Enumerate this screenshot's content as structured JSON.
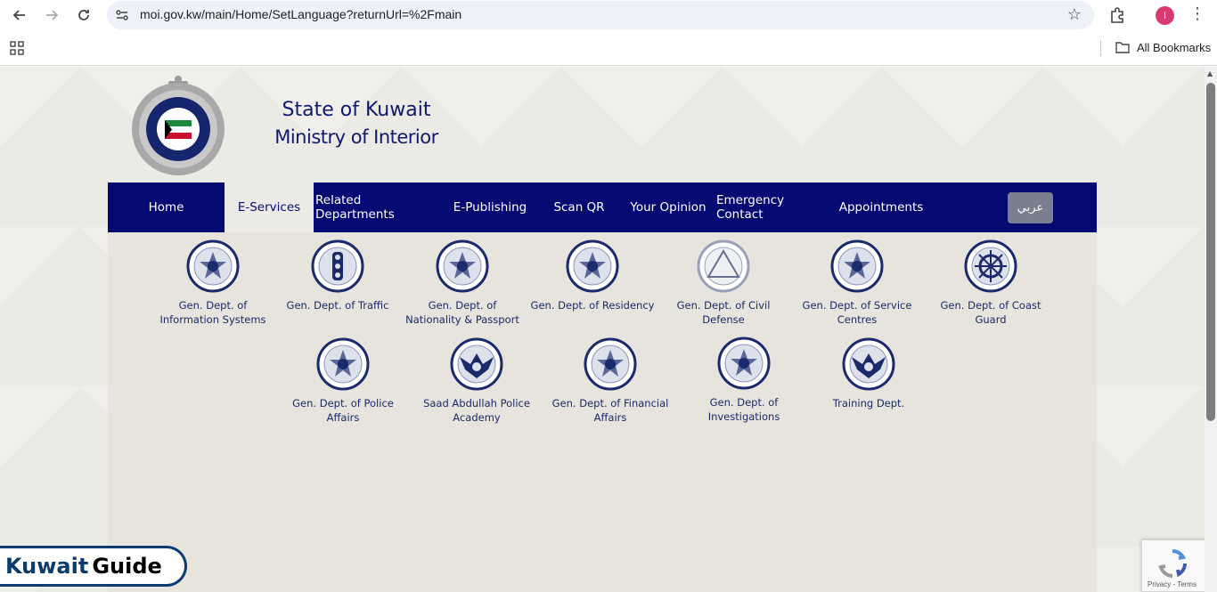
{
  "browser": {
    "url": "moi.gov.kw/main/Home/SetLanguage?returnUrl=%2Fmain",
    "profile_initial": "I",
    "bookmarks_label": "All Bookmarks",
    "icons": [
      "back-icon",
      "forward-icon",
      "reload-icon",
      "site-info-icon",
      "star-icon",
      "extensions-icon",
      "more-icon",
      "apps-icon",
      "folder-icon"
    ]
  },
  "header": {
    "title_line1": "State of Kuwait",
    "title_line2": "Ministry of Interior"
  },
  "nav": {
    "items": [
      {
        "label": "Home",
        "active": false
      },
      {
        "label": "E-Services",
        "active": true
      },
      {
        "label": "Related Departments",
        "active": false
      },
      {
        "label": "E-Publishing",
        "active": false
      },
      {
        "label": "Scan QR",
        "active": false
      },
      {
        "label": "Your Opinion",
        "active": false
      },
      {
        "label": "Emergency Contact",
        "active": false
      },
      {
        "label": "Appointments",
        "active": false
      }
    ],
    "language_button": "عربي"
  },
  "services": [
    {
      "label": "Gen. Dept. of Information Systems",
      "icon": "star-emblem"
    },
    {
      "label": "Gen. Dept. of Traffic",
      "icon": "traffic-emblem"
    },
    {
      "label": "Gen. Dept. of Nationality & Passport",
      "icon": "star-emblem"
    },
    {
      "label": "Gen. Dept. of Residency",
      "icon": "star-emblem"
    },
    {
      "label": "Gen. Dept. of Civil Defense",
      "icon": "triangle-emblem"
    },
    {
      "label": "Gen. Dept. of Service Centres",
      "icon": "star-emblem"
    },
    {
      "label": "Gen. Dept. of Coast Guard",
      "icon": "wheel-emblem"
    },
    {
      "label": "Gen. Dept. of Police Affairs",
      "icon": "star-emblem"
    },
    {
      "label": "Saad Abdullah Police Academy",
      "icon": "eagle-emblem"
    },
    {
      "label": "Gen. Dept. of Financial Affairs",
      "icon": "star-emblem"
    },
    {
      "label": "Gen. Dept. of Investigations",
      "icon": "star-emblem"
    },
    {
      "label": "Training Dept.",
      "icon": "eagle-emblem"
    }
  ],
  "watermark": {
    "part1": "Kuwait",
    "part2": "Guide"
  },
  "recaptcha": {
    "links": "Privacy - Terms"
  },
  "colors": {
    "navbar": "#050a73",
    "accent": "#0d1a6e",
    "page_bg": "#eceae4"
  }
}
